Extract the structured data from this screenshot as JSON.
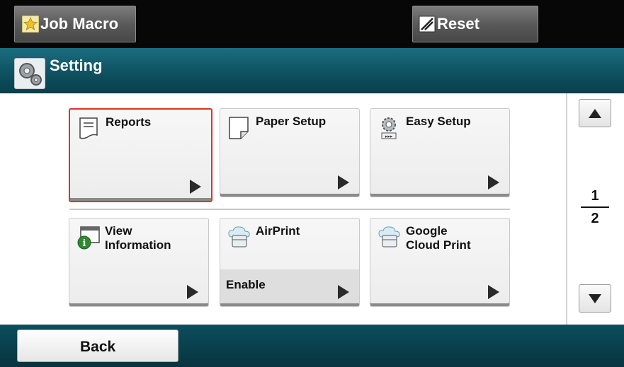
{
  "topbar": {
    "job_macro_label": "Job Macro",
    "reset_label": "Reset"
  },
  "title": {
    "text": "Setting"
  },
  "tiles": [
    {
      "label": "Reports",
      "icon": "reports-icon",
      "selected": true
    },
    {
      "label": "Paper Setup",
      "icon": "paper-icon"
    },
    {
      "label": "Easy Setup",
      "icon": "gear-icon"
    },
    {
      "label": "View Information",
      "icon": "info-icon"
    },
    {
      "label": "AirPrint",
      "icon": "cloud-printer-icon",
      "status": "Enable"
    },
    {
      "label": "Google Cloud Print",
      "icon": "cloud-printer-icon"
    }
  ],
  "pager": {
    "current": "1",
    "total": "2"
  },
  "bottombar": {
    "back_label": "Back"
  },
  "colors": {
    "selected_border": "#e0302a",
    "title_bar": "#0e4f5e"
  }
}
